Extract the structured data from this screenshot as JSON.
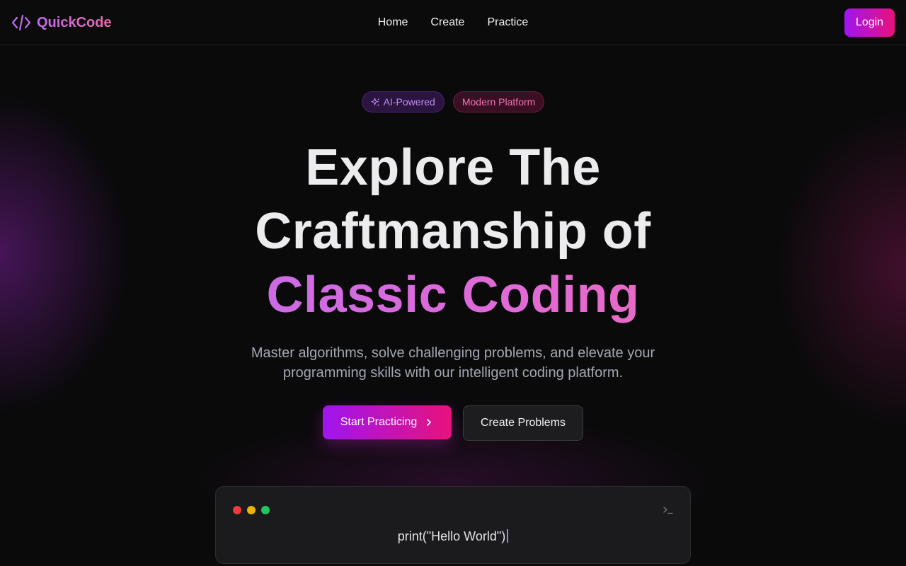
{
  "header": {
    "brand": "QuickCode",
    "nav": [
      {
        "label": "Home"
      },
      {
        "label": "Create"
      },
      {
        "label": "Practice"
      }
    ],
    "login_label": "Login"
  },
  "hero": {
    "badges": [
      {
        "label": "AI-Powered",
        "icon": "sparkle-icon"
      },
      {
        "label": "Modern Platform"
      }
    ],
    "title_line1": "Explore The",
    "title_line2": "Craftmanship of",
    "title_highlight": "Classic Coding",
    "subtitle": "Master algorithms, solve challenging problems, and elevate your programming skills with our intelligent coding platform.",
    "primary_cta": "Start Practicing",
    "secondary_cta": "Create Problems"
  },
  "terminal": {
    "code": "print(\"Hello World\")",
    "icon": "terminal-prompt-icon"
  },
  "colors": {
    "accent_start": "#9f15f0",
    "accent_end": "#e8127c",
    "background": "#0a0a0b"
  }
}
